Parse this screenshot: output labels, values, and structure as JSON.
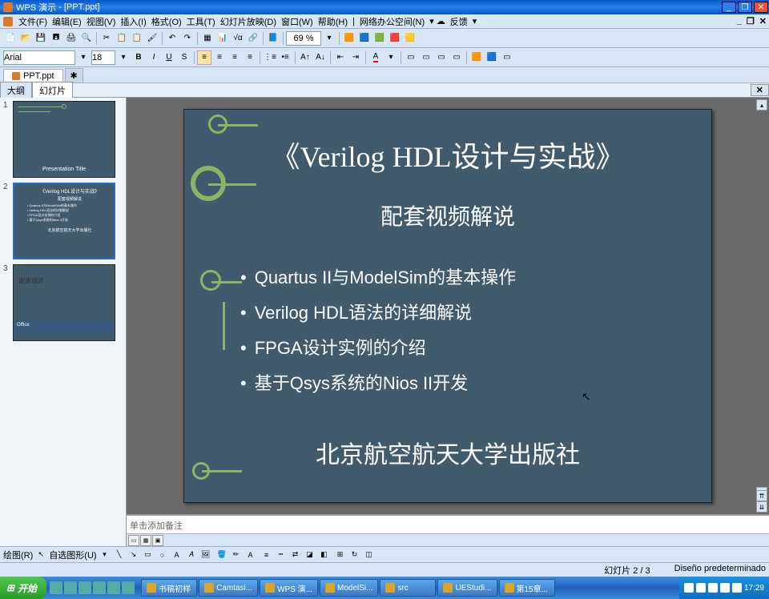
{
  "titlebar": {
    "appname": "WPS 演示",
    "filename": "[PPT.ppt]"
  },
  "menu": {
    "file": "文件(F)",
    "edit": "编辑(E)",
    "view": "视图(V)",
    "insert": "插入(I)",
    "format": "格式(O)",
    "tools": "工具(T)",
    "slideshow": "幻灯片放映(D)",
    "window": "窗口(W)",
    "help": "帮助(H)",
    "network": "网络办公空间(N)",
    "feedback": "反馈"
  },
  "toolbar1": {
    "zoom": "69 %"
  },
  "toolbar2": {
    "font": "Arial",
    "size": "18"
  },
  "tab": {
    "filename": "PPT.ppt"
  },
  "outline": {
    "tab_outline": "大纲",
    "tab_slides": "幻灯片"
  },
  "thumbs": {
    "1": {
      "title": "Presentation Title"
    },
    "2": {
      "line1": "《Verilog HDL设计与实战》",
      "line2": "配套视频解说",
      "b1": "Quartus II与ModelSim的基本操作",
      "b2": "Verilog HDL语法的详细解说",
      "b3": "FPGA设计实例的介绍",
      "b4": "基于Qsys系统的Nios II开发",
      "pub": "北京航空航天大学出版社"
    },
    "3": {
      "thanks": "谢谢观赏",
      "office": "Office"
    }
  },
  "slide": {
    "title": "《Verilog HDL设计与实战》",
    "subtitle": "配套视频解说",
    "bullet1": "Quartus II与ModelSim的基本操作",
    "bullet2": "Verilog HDL语法的详细解说",
    "bullet3": "FPGA设计实例的介绍",
    "bullet4": "基于Qsys系统的Nios II开发",
    "publisher": "北京航空航天大学出版社"
  },
  "notes": {
    "placeholder": "单击添加备注"
  },
  "draw": {
    "label": "绘图(R)",
    "autoshape": "自选图形(U)"
  },
  "status": {
    "slide": "幻灯片 2 / 3",
    "design": "Diseño predeterminado"
  },
  "taskbar": {
    "start": "开始",
    "tasks": [
      "书稿初样",
      "Camtasi...",
      "WPS 演...",
      "ModelSi...",
      "src",
      "UEStudi...",
      "第15章..."
    ],
    "time": "17:29"
  }
}
